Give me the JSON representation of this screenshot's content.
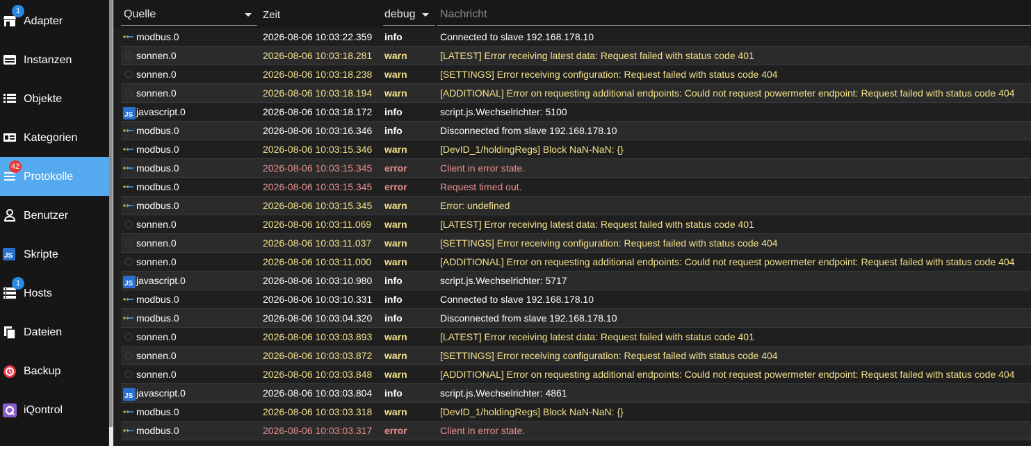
{
  "sidebar": {
    "items": [
      {
        "label": "Adapter",
        "icon": "store-icon",
        "badge": "1",
        "badge_color": "#2a88e0"
      },
      {
        "label": "Instanzen",
        "icon": "instances-icon"
      },
      {
        "label": "Objekte",
        "icon": "list-icon"
      },
      {
        "label": "Kategorien",
        "icon": "categories-icon"
      },
      {
        "label": "Protokolle",
        "icon": "log-icon",
        "badge": "42",
        "badge_color": "#e53935",
        "active": true
      },
      {
        "label": "Benutzer",
        "icon": "user-icon"
      },
      {
        "label": "Skripte",
        "icon": "javascript-icon"
      },
      {
        "label": "Hosts",
        "icon": "hosts-icon",
        "badge": "1",
        "badge_color": "#2a88e0"
      },
      {
        "label": "Dateien",
        "icon": "files-icon"
      },
      {
        "label": "Backup",
        "icon": "backup-icon"
      },
      {
        "label": "iQontrol",
        "icon": "iqontrol-icon"
      }
    ]
  },
  "header": {
    "source_label": "Quelle",
    "time_label": "Zeit",
    "level_label": "debug",
    "message_placeholder": "Nachricht"
  },
  "log": [
    {
      "source": "modbus.0",
      "icon": "modbus-icon",
      "time": "2026-08-06 10:03:22.359",
      "severity": "info",
      "message": "Connected to slave 192.168.178.10"
    },
    {
      "source": "sonnen.0",
      "icon": "sonnen-icon",
      "time": "2026-08-06 10:03:18.281",
      "severity": "warn",
      "message": "[LATEST] Error receiving latest data: Request failed with status code 401"
    },
    {
      "source": "sonnen.0",
      "icon": "sonnen-icon",
      "time": "2026-08-06 10:03:18.238",
      "severity": "warn",
      "message": "[SETTINGS] Error receiving configuration: Request failed with status code 404"
    },
    {
      "source": "sonnen.0",
      "icon": "sonnen-icon",
      "time": "2026-08-06 10:03:18.194",
      "severity": "warn",
      "message": "[ADDITIONAL] Error on requesting additional endpoints: Could not request powermeter endpoint: Request failed with status code 404"
    },
    {
      "source": "javascript.0",
      "icon": "javascript-icon",
      "time": "2026-08-06 10:03:18.172",
      "severity": "info",
      "message": "script.js.Wechselrichter: 5100"
    },
    {
      "source": "modbus.0",
      "icon": "modbus-icon",
      "time": "2026-08-06 10:03:16.346",
      "severity": "info",
      "message": "Disconnected from slave 192.168.178.10"
    },
    {
      "source": "modbus.0",
      "icon": "modbus-icon",
      "time": "2026-08-06 10:03:15.346",
      "severity": "warn",
      "message": "[DevID_1/holdingRegs] Block NaN-NaN: {}"
    },
    {
      "source": "modbus.0",
      "icon": "modbus-icon",
      "time": "2026-08-06 10:03:15.345",
      "severity": "error",
      "message": "Client in error state."
    },
    {
      "source": "modbus.0",
      "icon": "modbus-icon",
      "time": "2026-08-06 10:03:15.345",
      "severity": "error",
      "message": "Request timed out."
    },
    {
      "source": "modbus.0",
      "icon": "modbus-icon",
      "time": "2026-08-06 10:03:15.345",
      "severity": "warn",
      "message": "Error: undefined"
    },
    {
      "source": "sonnen.0",
      "icon": "sonnen-icon",
      "time": "2026-08-06 10:03:11.069",
      "severity": "warn",
      "message": "[LATEST] Error receiving latest data: Request failed with status code 401"
    },
    {
      "source": "sonnen.0",
      "icon": "sonnen-icon",
      "time": "2026-08-06 10:03:11.037",
      "severity": "warn",
      "message": "[SETTINGS] Error receiving configuration: Request failed with status code 404"
    },
    {
      "source": "sonnen.0",
      "icon": "sonnen-icon",
      "time": "2026-08-06 10:03:11.000",
      "severity": "warn",
      "message": "[ADDITIONAL] Error on requesting additional endpoints: Could not request powermeter endpoint: Request failed with status code 404"
    },
    {
      "source": "javascript.0",
      "icon": "javascript-icon",
      "time": "2026-08-06 10:03:10.980",
      "severity": "info",
      "message": "script.js.Wechselrichter: 5717"
    },
    {
      "source": "modbus.0",
      "icon": "modbus-icon",
      "time": "2026-08-06 10:03:10.331",
      "severity": "info",
      "message": "Connected to slave 192.168.178.10"
    },
    {
      "source": "modbus.0",
      "icon": "modbus-icon",
      "time": "2026-08-06 10:03:04.320",
      "severity": "info",
      "message": "Disconnected from slave 192.168.178.10"
    },
    {
      "source": "sonnen.0",
      "icon": "sonnen-icon",
      "time": "2026-08-06 10:03:03.893",
      "severity": "warn",
      "message": "[LATEST] Error receiving latest data: Request failed with status code 401"
    },
    {
      "source": "sonnen.0",
      "icon": "sonnen-icon",
      "time": "2026-08-06 10:03:03.872",
      "severity": "warn",
      "message": "[SETTINGS] Error receiving configuration: Request failed with status code 404"
    },
    {
      "source": "sonnen.0",
      "icon": "sonnen-icon",
      "time": "2026-08-06 10:03:03.848",
      "severity": "warn",
      "message": "[ADDITIONAL] Error on requesting additional endpoints: Could not request powermeter endpoint: Request failed with status code 404"
    },
    {
      "source": "javascript.0",
      "icon": "javascript-icon",
      "time": "2026-08-06 10:03:03.804",
      "severity": "info",
      "message": "script.js.Wechselrichter: 4861"
    },
    {
      "source": "modbus.0",
      "icon": "modbus-icon",
      "time": "2026-08-06 10:03:03.318",
      "severity": "warn",
      "message": "[DevID_1/holdingRegs] Block NaN-NaN: {}"
    },
    {
      "source": "modbus.0",
      "icon": "modbus-icon",
      "time": "2026-08-06 10:03:03.317",
      "severity": "error",
      "message": "Client in error state."
    }
  ]
}
